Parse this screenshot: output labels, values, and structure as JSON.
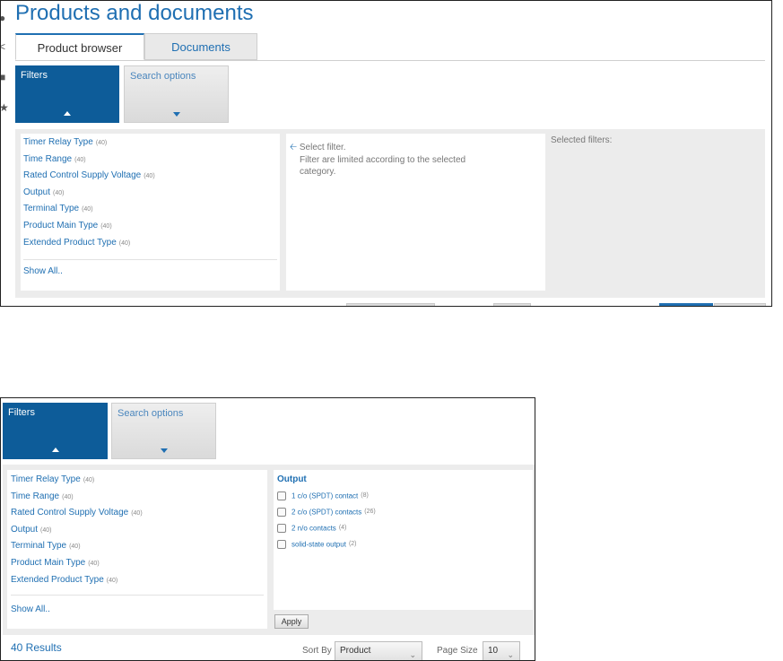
{
  "panel1": {
    "title": "Products and documents",
    "tabs": [
      {
        "label": "Product browser",
        "active": true
      },
      {
        "label": "Documents",
        "active": false
      }
    ],
    "side_icons": [
      "info-icon",
      "share-icon",
      "lock-icon",
      "star-icon"
    ],
    "filters_button": "Filters",
    "search_options_button": "Search options",
    "filter_list": [
      {
        "label": "Timer Relay Type",
        "count": "(40)"
      },
      {
        "label": "Time Range",
        "count": "(40)"
      },
      {
        "label": "Rated Control Supply Voltage",
        "count": "(40)"
      },
      {
        "label": "Output",
        "count": "(40)"
      },
      {
        "label": "Terminal Type",
        "count": "(40)"
      },
      {
        "label": "Product Main Type",
        "count": "(40)"
      },
      {
        "label": "Extended Product Type",
        "count": "(40)"
      }
    ],
    "show_all": "Show All..",
    "select_filter": "Select filter.",
    "filter_hint": "Filter are limited according to the selected category.",
    "selected_filters": "Selected filters:"
  },
  "panel2": {
    "filters_button": "Filters",
    "search_options_button": "Search options",
    "filter_list": [
      {
        "label": "Timer Relay Type",
        "count": "(40)"
      },
      {
        "label": "Time Range",
        "count": "(40)"
      },
      {
        "label": "Rated Control Supply Voltage",
        "count": "(40)"
      },
      {
        "label": "Output",
        "count": "(40)"
      },
      {
        "label": "Terminal Type",
        "count": "(40)"
      },
      {
        "label": "Product Main Type",
        "count": "(40)"
      },
      {
        "label": "Extended Product Type",
        "count": "(40)"
      }
    ],
    "show_all": "Show All..",
    "output_heading": "Output",
    "output_options": [
      {
        "label": "1 c/o (SPDT) contact",
        "count": "(8)",
        "checked": false
      },
      {
        "label": "2 c/o (SPDT) contacts",
        "count": "(26)",
        "checked": false
      },
      {
        "label": "2 n/o contacts",
        "count": "(4)",
        "checked": false
      },
      {
        "label": "solid-state output",
        "count": "(2)",
        "checked": false
      }
    ],
    "apply_button": "Apply",
    "results": "40 Results",
    "sort_by_label": "Sort By",
    "sort_by_value": "Product",
    "page_size_label": "Page Size",
    "page_size_value": "10"
  },
  "colors": {
    "brand_blue": "#1f6fb2",
    "filters_bg": "#0d5c99",
    "panel_grey": "#ececec"
  }
}
